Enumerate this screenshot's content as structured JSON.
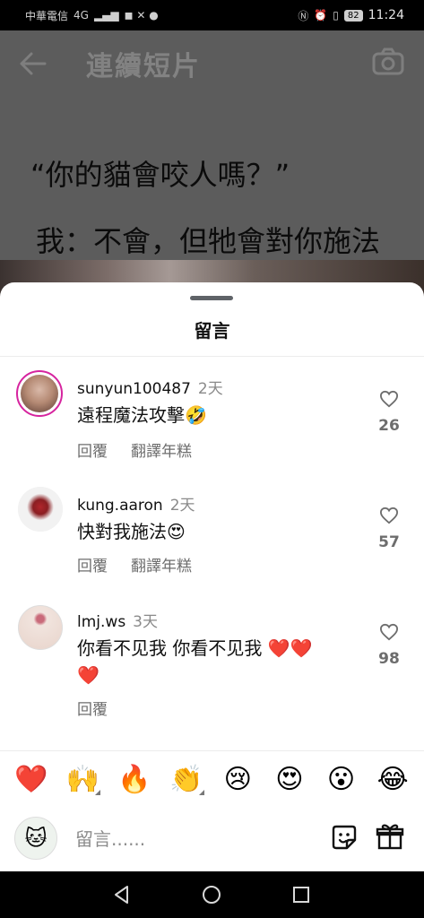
{
  "status_bar": {
    "carrier": "中華電信",
    "network": "4G",
    "battery": "82",
    "time": "11:24"
  },
  "video": {
    "title": "連續短片",
    "caption_line1": "“你的貓會咬人嗎？”",
    "caption_line2": "我：不會，但牠會對你施法"
  },
  "sheet": {
    "title": "留言",
    "comments": [
      {
        "username": "sunyun100487",
        "time": "2天",
        "text": "遠程魔法攻擊🤣",
        "reply_label": "回覆",
        "translate_label": "翻譯年糕",
        "likes": "26"
      },
      {
        "username": "kung.aaron",
        "time": "2天",
        "text": "快對我施法😍",
        "reply_label": "回覆",
        "translate_label": "翻譯年糕",
        "likes": "57"
      },
      {
        "username": "lmj.ws",
        "time": "3天",
        "text_line1": "你看不见我 你看不见我 ❤️❤️",
        "text_line2": "❤️",
        "reply_label": "回覆",
        "likes": "98"
      }
    ],
    "emojis": [
      "❤️",
      "🙌",
      "🔥",
      "👏",
      "😢",
      "😍",
      "😮",
      "😂"
    ],
    "input_placeholder": "留言......"
  }
}
